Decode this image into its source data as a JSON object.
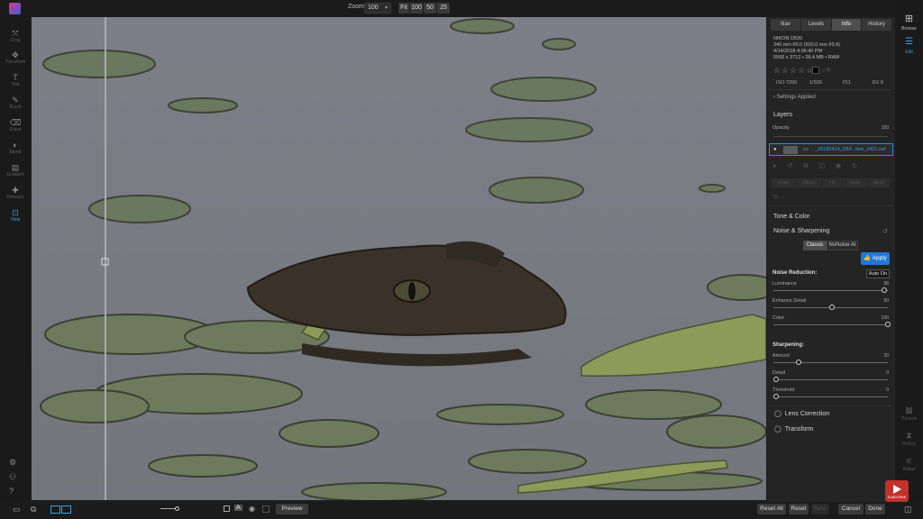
{
  "toolbar": {
    "zoom_label": "Zoom",
    "zoom_value": "100",
    "zoom_buttons": [
      "Fit",
      "100",
      "50",
      "25"
    ]
  },
  "left_tools": [
    {
      "icon": "move-icon",
      "label": "Crop"
    },
    {
      "icon": "transform-icon",
      "label": "Transform"
    },
    {
      "icon": "text-icon",
      "label": "Text"
    },
    {
      "icon": "brush-icon",
      "label": "Brush"
    },
    {
      "icon": "erase-icon",
      "label": "Erase"
    },
    {
      "icon": "blend-icon",
      "label": "Blend"
    },
    {
      "icon": "gradient-icon",
      "label": "Gradient"
    },
    {
      "icon": "retouch-icon",
      "label": "Retouch"
    },
    {
      "icon": "view-icon",
      "label": "View"
    }
  ],
  "right_panel": {
    "tabs": [
      "Nav",
      "Levels",
      "Info",
      "History"
    ],
    "active_tab": "Info",
    "info_lines": [
      "NIKON D500",
      "340 mm f/0.0 (500.0 mm f/3.9)",
      "4/14/2018 4:06:40 PM",
      "5568 x 3712 • 28.4 MB • RAW"
    ],
    "rating": "☆☆☆☆☆",
    "exif": [
      "ISO 7200",
      "1/500",
      "f/11",
      "EV 0"
    ],
    "settings_applied": "Settings Applied",
    "layers_title": "Layers",
    "opacity_label": "Opacity",
    "opacity_value": "100",
    "layer_name": "_20180414_D50...tion_2421.nef",
    "layer_buttons": [
      "Invert",
      "Effects",
      "Fill",
      "Mask",
      "Blend"
    ],
    "tone_color": "Tone & Color",
    "noise_sharpening": "Noise & Sharpening",
    "mode_classic": "Classic",
    "mode_noiseai": "NoNoise AI",
    "apply": "Apply",
    "noise_reduction_title": "Noise Reduction:",
    "auto_on": "Auto On",
    "sliders_noise": [
      {
        "label": "Luminance",
        "value": "98",
        "pos": 0.97
      },
      {
        "label": "Enhance Detail",
        "value": "50",
        "pos": 0.5
      },
      {
        "label": "Color",
        "value": "100",
        "pos": 1.0
      }
    ],
    "sharpening_title": "Sharpening:",
    "sliders_sharp": [
      {
        "label": "Amount",
        "value": "20",
        "pos": 0.2
      },
      {
        "label": "Detail",
        "value": "0",
        "pos": 0.0
      },
      {
        "label": "Threshold",
        "value": "0",
        "pos": 0.0
      }
    ],
    "lens_correction": "Lens Correction",
    "transform": "Transform"
  },
  "far_right": {
    "browse": "Browse",
    "edit": "Edit",
    "presets": "Presets",
    "history": "History",
    "adjust": "Adjust"
  },
  "bottom": {
    "preview": "Preview",
    "reset_all": "Reset All",
    "reset": "Reset",
    "sync": "Sync",
    "cancel": "Cancel",
    "done": "Done",
    "subscribe": "SUBSCRIBE"
  }
}
